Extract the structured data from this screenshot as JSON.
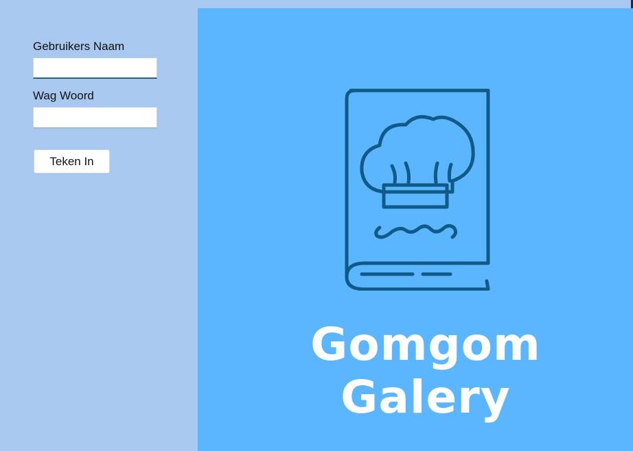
{
  "login": {
    "username_label": "Gebruikers Naam",
    "username_value": "",
    "password_label": "Wag Woord",
    "password_value": "",
    "signin_label": "Teken In"
  },
  "brand": {
    "name": "Gomgom Galery",
    "logo_icon": "chef-hat-cookbook-icon"
  },
  "colors": {
    "left_background": "#a8c8f0",
    "brand_background": "#5bb6ff",
    "logo_stroke": "#0f5a86",
    "brand_text": "#ffffff"
  }
}
